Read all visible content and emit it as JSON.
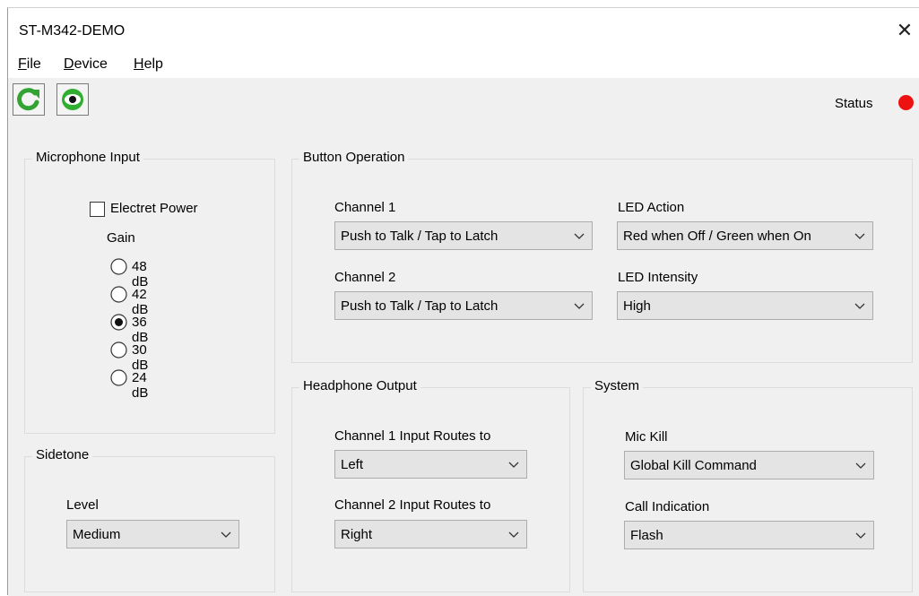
{
  "window": {
    "title": "ST-M342-DEMO"
  },
  "menu": {
    "file": "File",
    "device": "Device",
    "help": "Help"
  },
  "status": {
    "label": "Status",
    "color": "#ee1111"
  },
  "microphone_input": {
    "title": "Microphone Input",
    "electret_power_label": "Electret Power",
    "electret_power_checked": false,
    "gain_label": "Gain",
    "gain_options": [
      "48 dB",
      "42 dB",
      "36 dB",
      "30 dB",
      "24 dB"
    ],
    "gain_selected": "36 dB"
  },
  "sidetone": {
    "title": "Sidetone",
    "level_label": "Level",
    "level_value": "Medium"
  },
  "button_operation": {
    "title": "Button Operation",
    "channel1_label": "Channel 1",
    "channel1_value": "Push to Talk / Tap to Latch",
    "channel2_label": "Channel 2",
    "channel2_value": "Push to Talk / Tap to Latch",
    "led_action_label": "LED Action",
    "led_action_value": "Red when Off / Green when On",
    "led_intensity_label": "LED Intensity",
    "led_intensity_value": "High"
  },
  "headphone_output": {
    "title": "Headphone Output",
    "ch1_routes_label": "Channel 1 Input Routes to",
    "ch1_routes_value": "Left",
    "ch2_routes_label": "Channel 2 Input Routes to",
    "ch2_routes_value": "Right"
  },
  "system": {
    "title": "System",
    "mic_kill_label": "Mic Kill",
    "mic_kill_value": "Global Kill Command",
    "call_indication_label": "Call Indication",
    "call_indication_value": "Flash"
  },
  "icons": {
    "refresh": "refresh-icon",
    "view": "eye-icon",
    "close": "close-icon",
    "dropdown": "chevron-down-icon"
  }
}
